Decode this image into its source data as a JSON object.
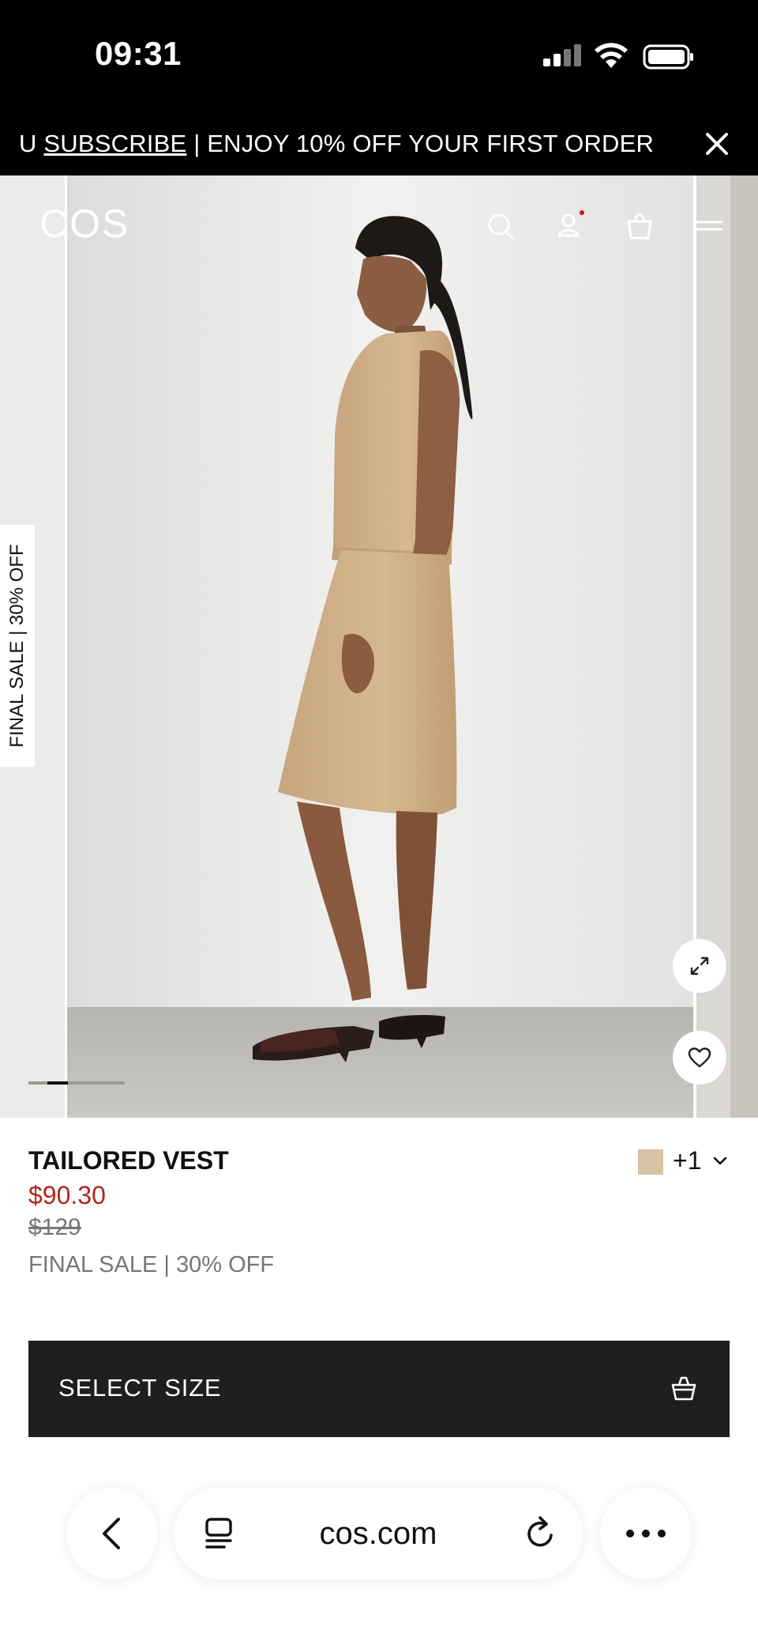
{
  "status_bar": {
    "time": "09:31"
  },
  "promo_banner": {
    "prefix": "U ",
    "link_label": "SUBSCRIBE",
    "suffix": " | ENJOY 10% OFF YOUR FIRST ORDER"
  },
  "header": {
    "logo": "COS",
    "account_badge_color": "#d0021b"
  },
  "hero": {
    "side_tab_label": "FINAL SALE | 30% OFF",
    "carousel_progress": {
      "current": 2,
      "total": 5
    }
  },
  "product": {
    "name": "TAILORED VEST",
    "sale_price": "$90.30",
    "original_price": "$129",
    "sale_label": "FINAL SALE | 30% OFF",
    "swatch_color": "#d9c2a4",
    "more_colors": "+1"
  },
  "actions": {
    "select_size_label": "SELECT SIZE"
  },
  "browser": {
    "url": "cos.com"
  },
  "colors": {
    "accent_sale": "#b3261e",
    "button_bg": "#1f1f1f"
  }
}
